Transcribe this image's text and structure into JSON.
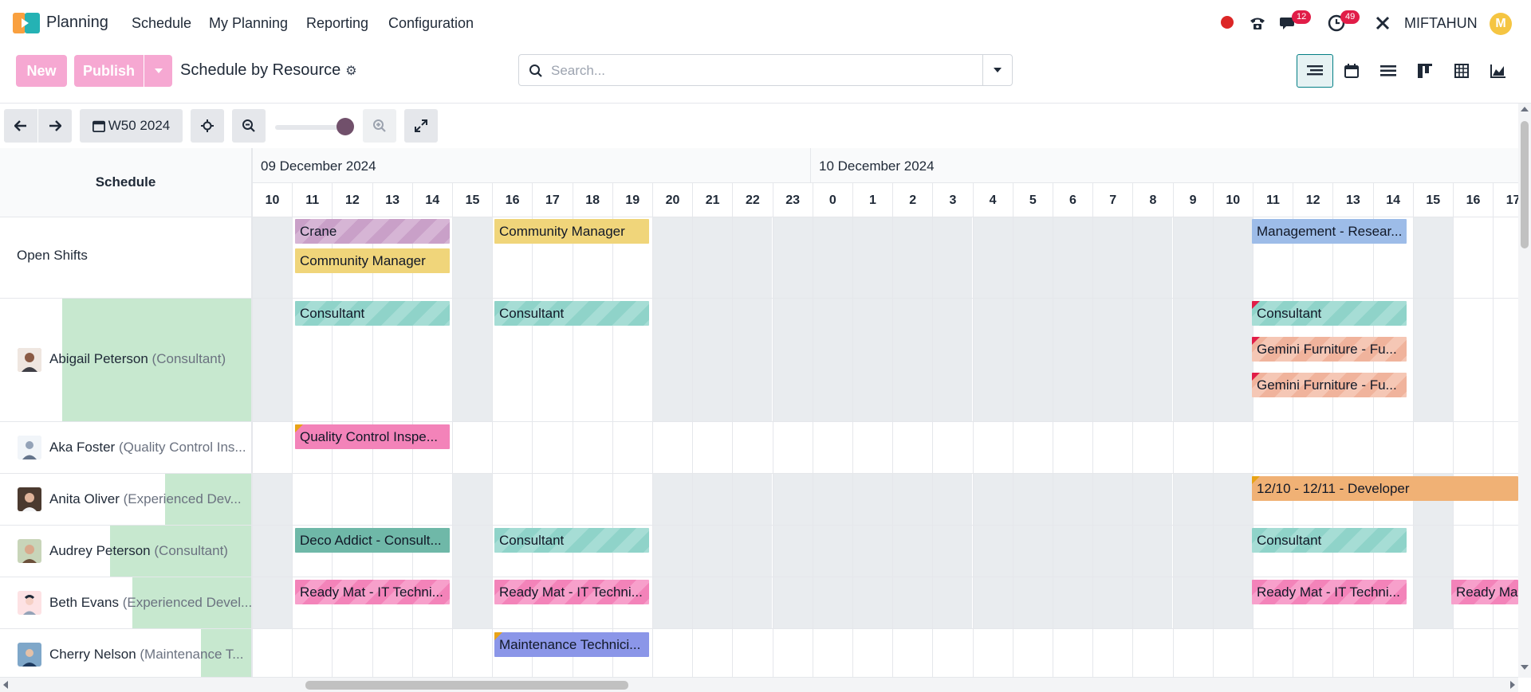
{
  "nav": {
    "app": "Planning",
    "menus": [
      "Schedule",
      "My Planning",
      "Reporting",
      "Configuration"
    ],
    "messages_count": "12",
    "activities_count": "49",
    "user": "MIFTAHUN",
    "user_initial": "M"
  },
  "controls": {
    "new_label": "New",
    "publish_label": "Publish",
    "breadcrumb": "Schedule by Resource",
    "search_placeholder": "Search..."
  },
  "toolbar": {
    "period_label": "W50 2024"
  },
  "gantt": {
    "corner_label": "Schedule",
    "days": [
      "09 December 2024",
      "10 December 2024"
    ],
    "hours": [
      "10",
      "11",
      "12",
      "13",
      "14",
      "15",
      "16",
      "17",
      "18",
      "19",
      "20",
      "21",
      "22",
      "23",
      "0",
      "1",
      "2",
      "3",
      "4",
      "5",
      "6",
      "7",
      "8",
      "9",
      "10",
      "11",
      "12",
      "13",
      "14",
      "15",
      "16",
      "17"
    ],
    "rows": [
      {
        "name": "Open Shifts",
        "job": "",
        "pills": [
          "Crane",
          "Community Manager",
          "Community Manager",
          "Management - Resear..."
        ]
      },
      {
        "name": "Abigail Peterson",
        "job": "(Consultant)",
        "pills": [
          "Consultant",
          "Consultant",
          "Consultant",
          "Gemini Furniture - Fu...",
          "Gemini Furniture - Fu..."
        ]
      },
      {
        "name": "Aka Foster",
        "job": "(Quality Control Ins...",
        "pills": [
          "Quality Control Inspe..."
        ]
      },
      {
        "name": "Anita Oliver",
        "job": "(Experienced Dev...",
        "pills": [
          "12/10 - 12/11 - Developer"
        ]
      },
      {
        "name": "Audrey Peterson",
        "job": "(Consultant)",
        "pills": [
          "Deco Addict - Consult...",
          "Consultant",
          "Consultant"
        ]
      },
      {
        "name": "Beth Evans",
        "job": "(Experienced Devel...",
        "pills": [
          "Ready Mat - IT Techni...",
          "Ready Mat - IT Techni...",
          "Ready Mat - IT Techni...",
          "Ready Ma"
        ]
      },
      {
        "name": "Cherry Nelson",
        "job": "(Maintenance T...",
        "pills": [
          "Maintenance Technici..."
        ]
      }
    ]
  },
  "colors": {
    "primary": "#71506b",
    "publish": "#f6a8d2",
    "allocated_fill": "#c7e8cf",
    "off_hours": "#e9ecef"
  }
}
